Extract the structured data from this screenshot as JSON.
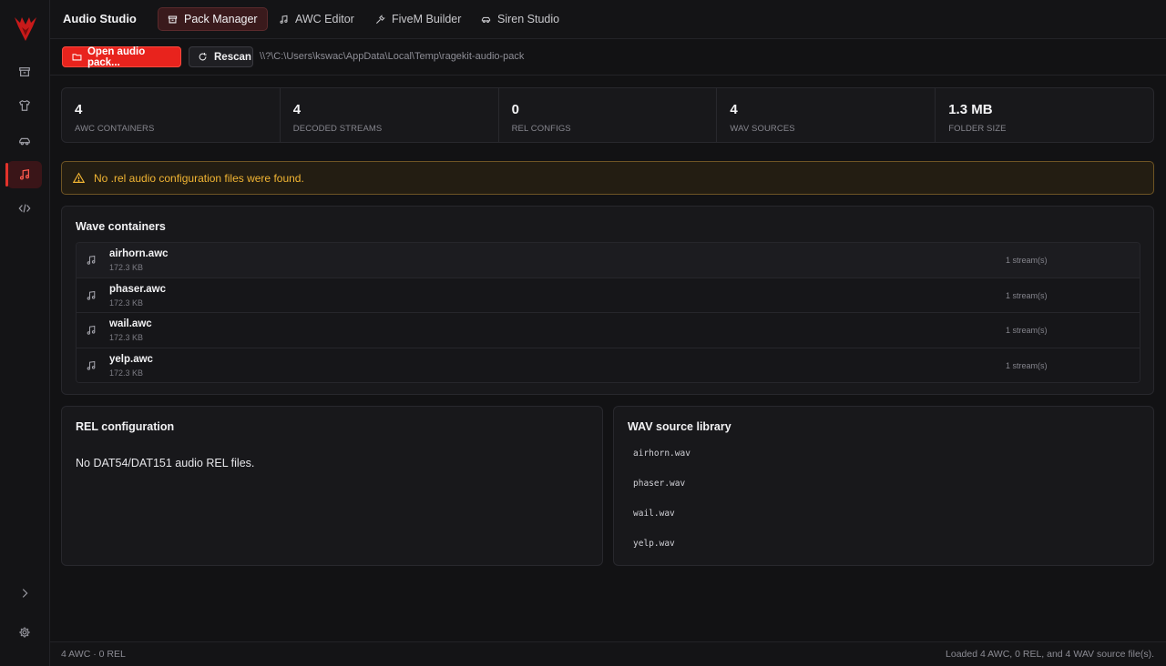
{
  "app": {
    "title": "Audio Studio"
  },
  "tabs": [
    {
      "label": "Pack Manager",
      "icon": "archive-icon",
      "active": true
    },
    {
      "label": "AWC Editor",
      "icon": "music-note-icon",
      "active": false
    },
    {
      "label": "FiveM Builder",
      "icon": "wrench-icon",
      "active": false
    },
    {
      "label": "Siren Studio",
      "icon": "car-icon",
      "active": false
    }
  ],
  "toolbar": {
    "open_label": "Open audio pack...",
    "rescan_label": "Rescan",
    "path": "\\\\?\\C:\\Users\\kswac\\AppData\\Local\\Temp\\ragekit-audio-pack"
  },
  "stats": [
    {
      "value": "4",
      "label": "AWC CONTAINERS"
    },
    {
      "value": "4",
      "label": "DECODED STREAMS"
    },
    {
      "value": "0",
      "label": "REL CONFIGS"
    },
    {
      "value": "4",
      "label": "WAV SOURCES"
    },
    {
      "value": "1.3 MB",
      "label": "FOLDER SIZE"
    }
  ],
  "warning": {
    "text": "No .rel audio configuration files were found."
  },
  "wave": {
    "title": "Wave containers",
    "items": [
      {
        "name": "airhorn.awc",
        "size": "172.3 KB",
        "streams": "1 stream(s)"
      },
      {
        "name": "phaser.awc",
        "size": "172.3 KB",
        "streams": "1 stream(s)"
      },
      {
        "name": "wail.awc",
        "size": "172.3 KB",
        "streams": "1 stream(s)"
      },
      {
        "name": "yelp.awc",
        "size": "172.3 KB",
        "streams": "1 stream(s)"
      }
    ]
  },
  "rel": {
    "title": "REL configuration",
    "empty_text": "No DAT54/DAT151 audio REL files."
  },
  "wav": {
    "title": "WAV source library",
    "items": [
      "airhorn.wav",
      "phaser.wav",
      "wail.wav",
      "yelp.wav"
    ]
  },
  "status": {
    "left": "4 AWC · 0 REL",
    "right": "Loaded 4 AWC, 0 REL, and 4 WAV source file(s)."
  },
  "colors": {
    "accent": "#e8231d",
    "warning": "#f2b533"
  }
}
